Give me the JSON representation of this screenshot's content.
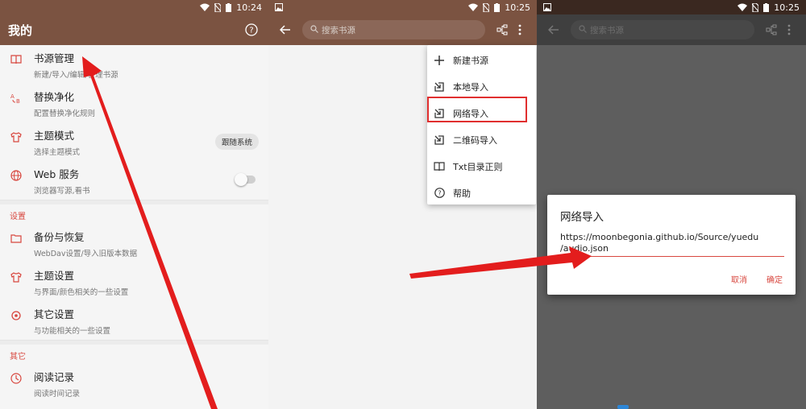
{
  "colors": {
    "accent": "#d8473f",
    "brand": "#7b5341",
    "highlight": "#e02f2f",
    "arrow": "#e31d1d"
  },
  "panel1": {
    "status": {
      "time": "10:24"
    },
    "appbar": {
      "title": "我的",
      "help_icon": "help-circle-icon"
    },
    "items": [
      {
        "title": "书源管理",
        "subtitle": "新建/导入/编辑/管理书源",
        "icon": "book-icon"
      },
      {
        "title": "替换净化",
        "subtitle": "配置替换净化规则",
        "icon": "replace-ab-icon"
      },
      {
        "title": "主题模式",
        "subtitle": "选择主题模式",
        "icon": "shirt-icon",
        "chip": "跟随系统"
      },
      {
        "title": "Web 服务",
        "subtitle": "浏览器写源,看书",
        "icon": "globe-icon",
        "toggle": false
      }
    ],
    "section_settings": "设置",
    "settings_items": [
      {
        "title": "备份与恢复",
        "subtitle": "WebDav设置/导入旧版本数据",
        "icon": "folder-icon"
      },
      {
        "title": "主题设置",
        "subtitle": "与界面/颜色相关的一些设置",
        "icon": "shirt-icon"
      },
      {
        "title": "其它设置",
        "subtitle": "与功能相关的一些设置",
        "icon": "gear-icon"
      }
    ],
    "section_other": "其它",
    "other_items": [
      {
        "title": "阅读记录",
        "subtitle": "阅读时间记录",
        "icon": "clock-icon"
      }
    ]
  },
  "panel2": {
    "status": {
      "time": "10:25"
    },
    "search": {
      "placeholder": "搜索书源"
    },
    "menu": [
      {
        "label": "新建书源",
        "icon": "plus-icon"
      },
      {
        "label": "本地导入",
        "icon": "import-icon"
      },
      {
        "label": "网络导入",
        "icon": "import-icon"
      },
      {
        "label": "二维码导入",
        "icon": "import-icon"
      },
      {
        "label": "Txt目录正则",
        "icon": "book-icon"
      },
      {
        "label": "帮助",
        "icon": "help-circle-icon"
      }
    ]
  },
  "panel3": {
    "status": {
      "time": "10:25"
    },
    "search": {
      "placeholder": "搜索书源"
    },
    "dialog": {
      "title": "网络导入",
      "url_line1": "https://moonbegonia.github.io/Source/yuedu",
      "url_line2": "/audio.json",
      "cancel": "取消",
      "confirm": "确定"
    }
  }
}
